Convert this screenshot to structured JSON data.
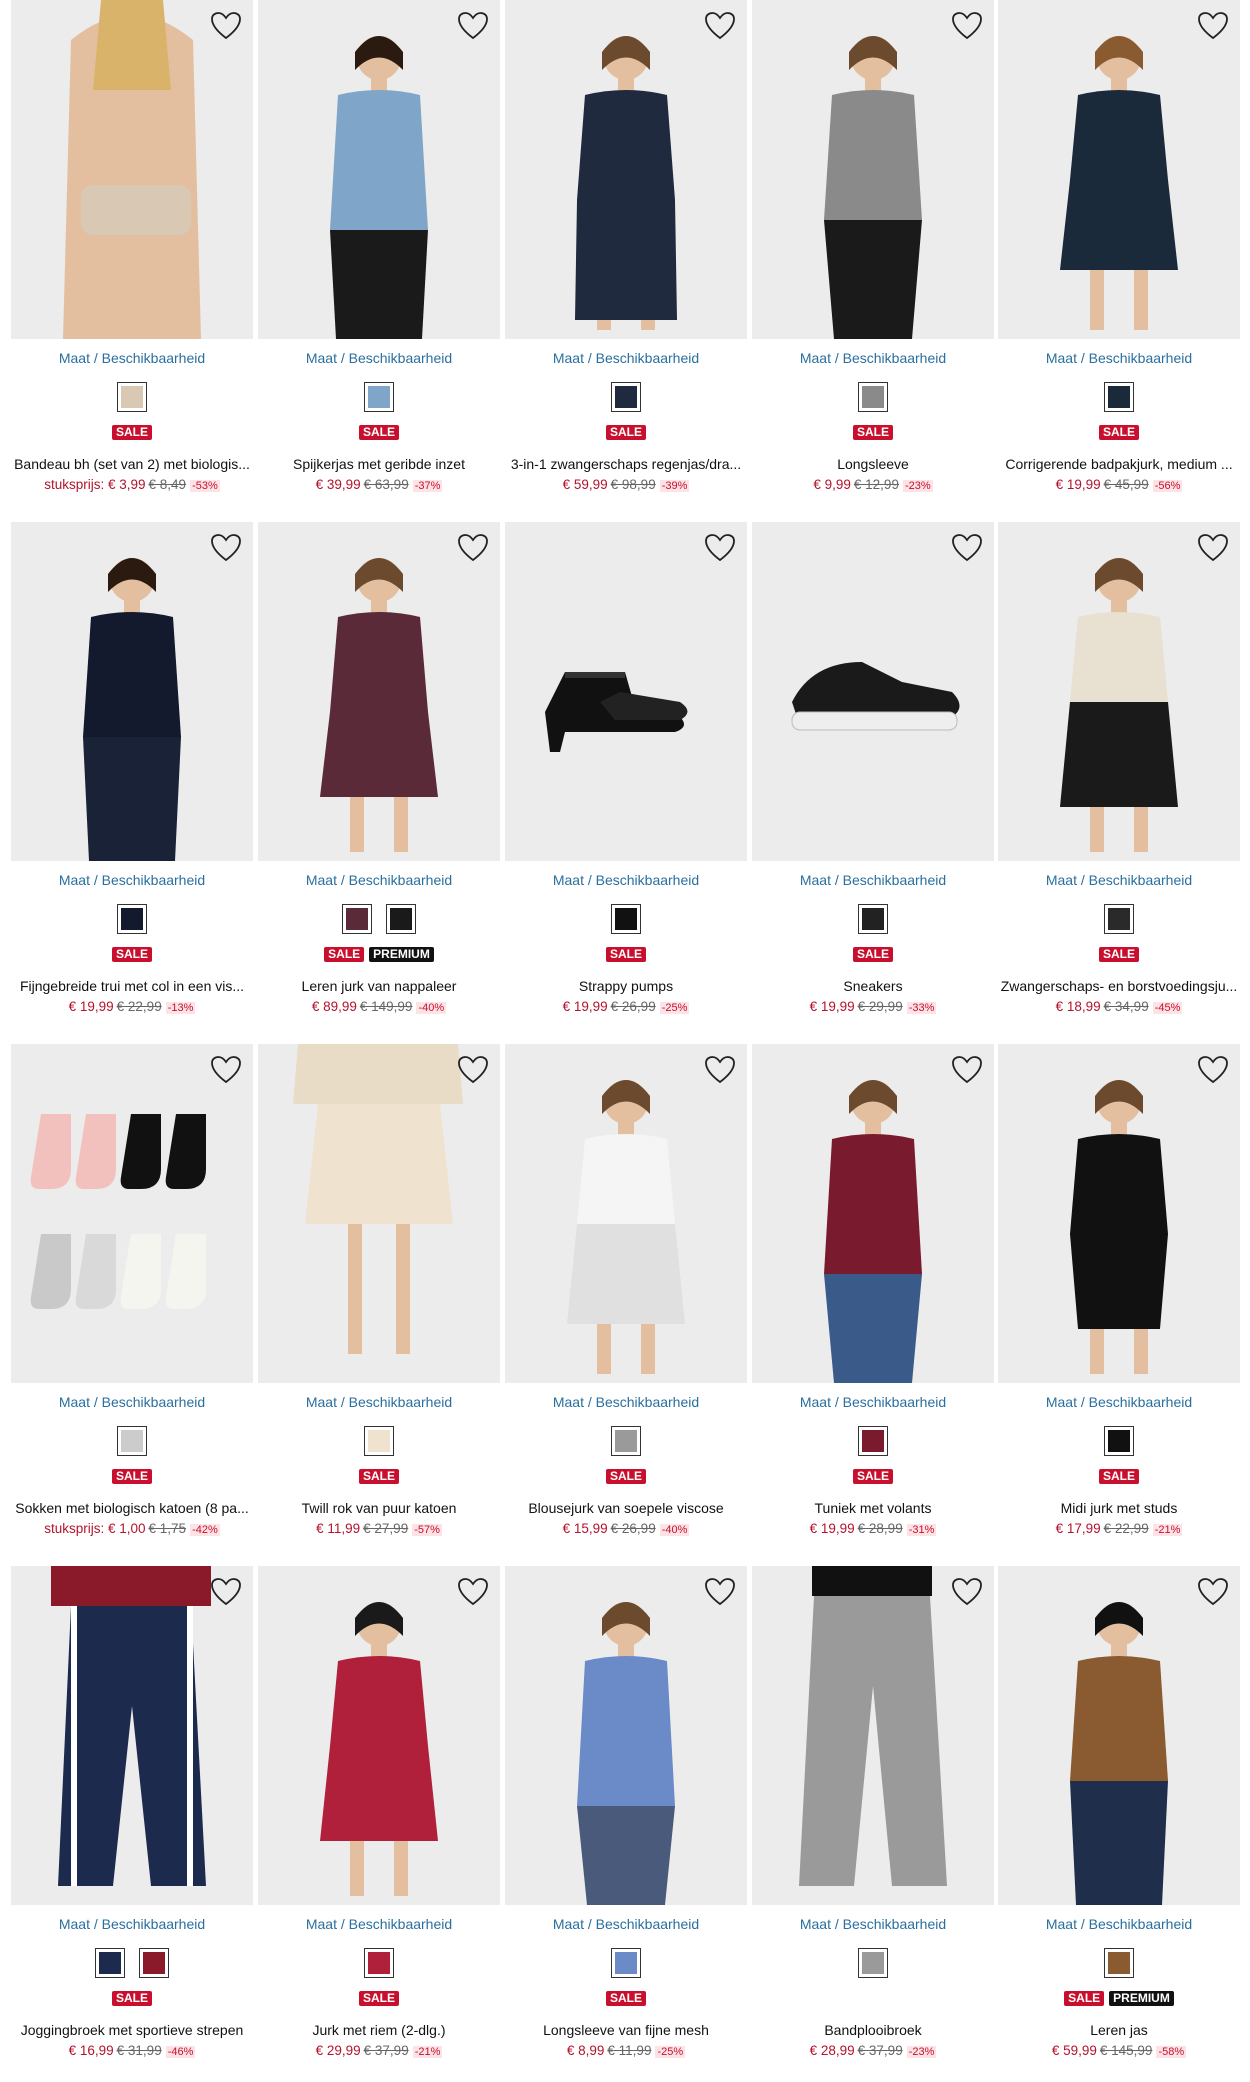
{
  "size_link_label": "Maat / Beschikbaarheid",
  "unit_price_label": "stuksprijs:",
  "colors": {
    "sale_badge": "#c8102e",
    "premium_badge": "#111111",
    "link": "#2a6f9e",
    "price": "#b3132d"
  },
  "products": [
    {
      "name": "Bandeau bh (set van 2) met biologis...",
      "unit": true,
      "price": "€ 3,99",
      "old_price": "€ 8,49",
      "discount": "-53%",
      "badges": [
        "SALE"
      ],
      "swatches": [
        "#d8c8b4"
      ],
      "icon": "bandeau-image"
    },
    {
      "name": "Spijkerjas met geribde inzet",
      "unit": false,
      "price": "€ 39,99",
      "old_price": "€ 63,99",
      "discount": "-37%",
      "badges": [
        "SALE"
      ],
      "swatches": [
        "#7fa5c8"
      ],
      "icon": "denim-jacket-image"
    },
    {
      "name": "3-in-1 zwangerschaps regenjas/dra...",
      "unit": false,
      "price": "€ 59,99",
      "old_price": "€ 98,99",
      "discount": "-39%",
      "badges": [
        "SALE"
      ],
      "swatches": [
        "#1f2a3e"
      ],
      "icon": "rain-jacket-image"
    },
    {
      "name": "Longsleeve",
      "unit": false,
      "price": "€ 9,99",
      "old_price": "€ 12,99",
      "discount": "-23%",
      "badges": [
        "SALE"
      ],
      "swatches": [
        "#8a8a8a"
      ],
      "icon": "longsleeve-image"
    },
    {
      "name": "Corrigerende badpakjurk, medium ...",
      "unit": false,
      "price": "€ 19,99",
      "old_price": "€ 45,99",
      "discount": "-56%",
      "badges": [
        "SALE"
      ],
      "swatches": [
        "#1a2a3a"
      ],
      "icon": "swimdress-image"
    },
    {
      "name": "Fijngebreide trui met col in een vis...",
      "unit": false,
      "price": "€ 19,99",
      "old_price": "€ 22,99",
      "discount": "-13%",
      "badges": [
        "SALE"
      ],
      "swatches": [
        "#141a2e"
      ],
      "icon": "turtleneck-image"
    },
    {
      "name": "Leren jurk van nappaleer",
      "unit": false,
      "price": "€ 89,99",
      "old_price": "€ 149,99",
      "discount": "-40%",
      "badges": [
        "SALE",
        "PREMIUM"
      ],
      "swatches": [
        "#5a2a38",
        "#1a1a1a"
      ],
      "icon": "leather-dress-image"
    },
    {
      "name": "Strappy pumps",
      "unit": false,
      "price": "€ 19,99",
      "old_price": "€ 26,99",
      "discount": "-25%",
      "badges": [
        "SALE"
      ],
      "swatches": [
        "#111111"
      ],
      "icon": "pumps-image"
    },
    {
      "name": "Sneakers",
      "unit": false,
      "price": "€ 19,99",
      "old_price": "€ 29,99",
      "discount": "-33%",
      "badges": [
        "SALE"
      ],
      "swatches": [
        "#222222"
      ],
      "icon": "sneakers-image"
    },
    {
      "name": "Zwangerschaps- en borstvoedingsju...",
      "unit": false,
      "price": "€ 18,99",
      "old_price": "€ 34,99",
      "discount": "-45%",
      "badges": [
        "SALE"
      ],
      "swatches": [
        "#2a2a2a"
      ],
      "icon": "print-dress-image"
    },
    {
      "name": "Sokken met biologisch katoen (8 pa...",
      "unit": true,
      "price": "€ 1,00",
      "old_price": "€ 1,75",
      "discount": "-42%",
      "badges": [
        "SALE"
      ],
      "swatches": [
        "#cccccc"
      ],
      "icon": "socks-image"
    },
    {
      "name": "Twill rok van puur katoen",
      "unit": false,
      "price": "€ 11,99",
      "old_price": "€ 27,99",
      "discount": "-57%",
      "badges": [
        "SALE"
      ],
      "swatches": [
        "#efe3cf"
      ],
      "icon": "twill-skirt-image"
    },
    {
      "name": "Blousejurk van soepele viscose",
      "unit": false,
      "price": "€ 15,99",
      "old_price": "€ 26,99",
      "discount": "-40%",
      "badges": [
        "SALE"
      ],
      "swatches": [
        "#9a9a9a"
      ],
      "icon": "striped-dress-image"
    },
    {
      "name": "Tuniek met volants",
      "unit": false,
      "price": "€ 19,99",
      "old_price": "€ 28,99",
      "discount": "-31%",
      "badges": [
        "SALE"
      ],
      "swatches": [
        "#7a1a2e"
      ],
      "icon": "ruffle-tunic-image"
    },
    {
      "name": "Midi jurk met studs",
      "unit": false,
      "price": "€ 17,99",
      "old_price": "€ 22,99",
      "discount": "-21%",
      "badges": [
        "SALE"
      ],
      "swatches": [
        "#111111"
      ],
      "icon": "midi-dress-image"
    },
    {
      "name": "Joggingbroek met sportieve strepen",
      "unit": false,
      "price": "€ 16,99",
      "old_price": "€ 31,99",
      "discount": "-46%",
      "badges": [
        "SALE"
      ],
      "swatches": [
        "#1c2a4e",
        "#8a1a2a"
      ],
      "icon": "joggers-image"
    },
    {
      "name": "Jurk met riem (2-dlg.)",
      "unit": false,
      "price": "€ 29,99",
      "old_price": "€ 37,99",
      "discount": "-21%",
      "badges": [
        "SALE"
      ],
      "swatches": [
        "#b0203a"
      ],
      "icon": "belted-dress-image"
    },
    {
      "name": "Longsleeve van fijne mesh",
      "unit": false,
      "price": "€ 8,99",
      "old_price": "€ 11,99",
      "discount": "-25%",
      "badges": [
        "SALE"
      ],
      "swatches": [
        "#6a8ac8"
      ],
      "icon": "mesh-top-image"
    },
    {
      "name": "Bandplooibroek",
      "unit": false,
      "price": "€ 28,99",
      "old_price": "€ 37,99",
      "discount": "-23%",
      "badges": [],
      "swatches": [
        "#9a9a9a"
      ],
      "icon": "pleated-trousers-image"
    },
    {
      "name": "Leren jas",
      "unit": false,
      "price": "€ 59,99",
      "old_price": "€ 145,99",
      "discount": "-58%",
      "badges": [
        "SALE",
        "PREMIUM"
      ],
      "swatches": [
        "#8a5a30"
      ],
      "icon": "leather-jacket-image"
    }
  ]
}
